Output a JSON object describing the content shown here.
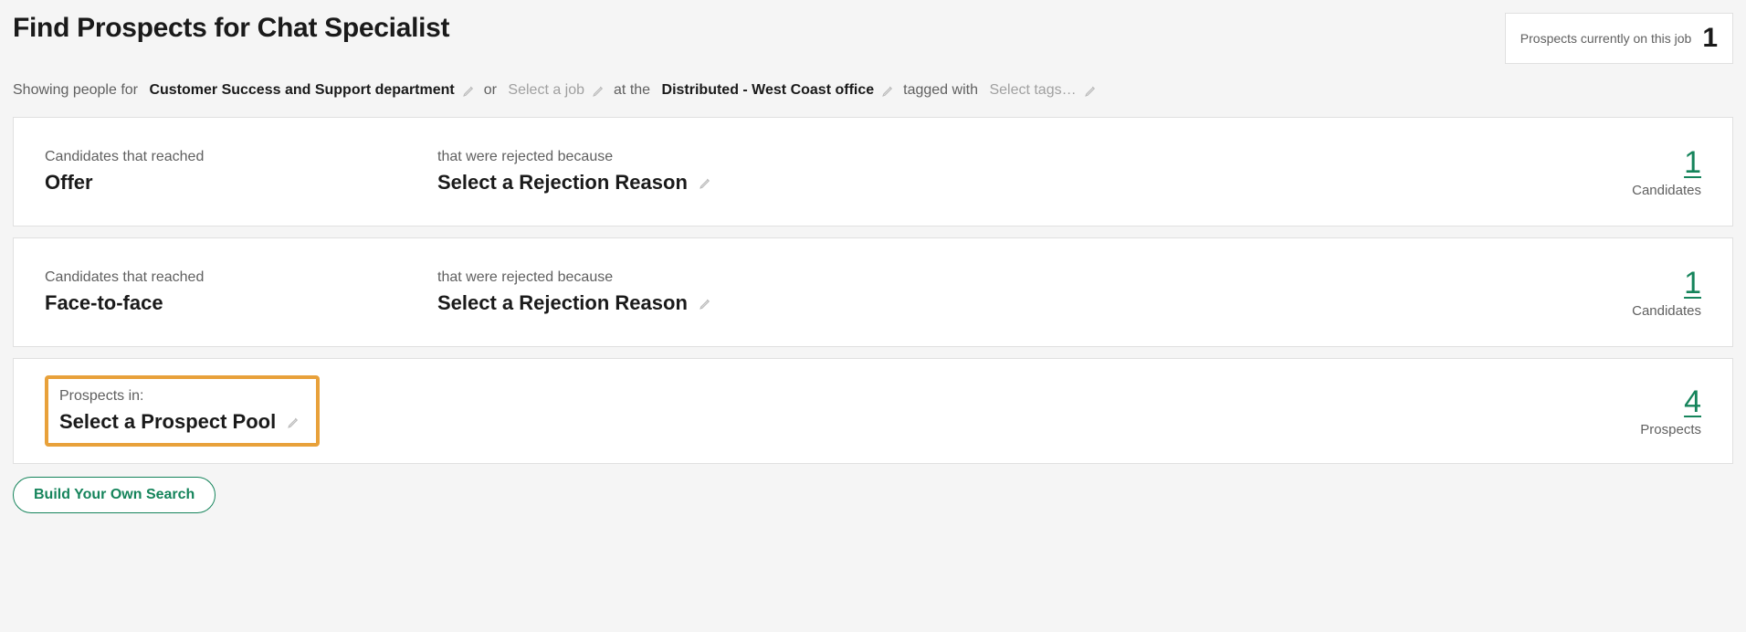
{
  "header": {
    "title": "Find Prospects for Chat Specialist",
    "badge_label": "Prospects currently on this job",
    "badge_count": "1"
  },
  "filter": {
    "prefix": "Showing people for",
    "department": "Customer Success and Support department",
    "or": "or",
    "job_placeholder": "Select a job",
    "at_the": "at the",
    "office": "Distributed - West Coast office",
    "tagged_with": "tagged with",
    "tags_placeholder": "Select tags…"
  },
  "cards": [
    {
      "stage_label": "Candidates that reached",
      "stage_value": "Offer",
      "reason_label": "that were rejected because",
      "reason_value": "Select a Rejection Reason",
      "count": "1",
      "count_label": "Candidates"
    },
    {
      "stage_label": "Candidates that reached",
      "stage_value": "Face-to-face",
      "reason_label": "that were rejected because",
      "reason_value": "Select a Rejection Reason",
      "count": "1",
      "count_label": "Candidates"
    }
  ],
  "prospects_card": {
    "label": "Prospects in:",
    "value": "Select a Prospect Pool",
    "count": "4",
    "count_label": "Prospects"
  },
  "build_btn": "Build Your Own Search"
}
